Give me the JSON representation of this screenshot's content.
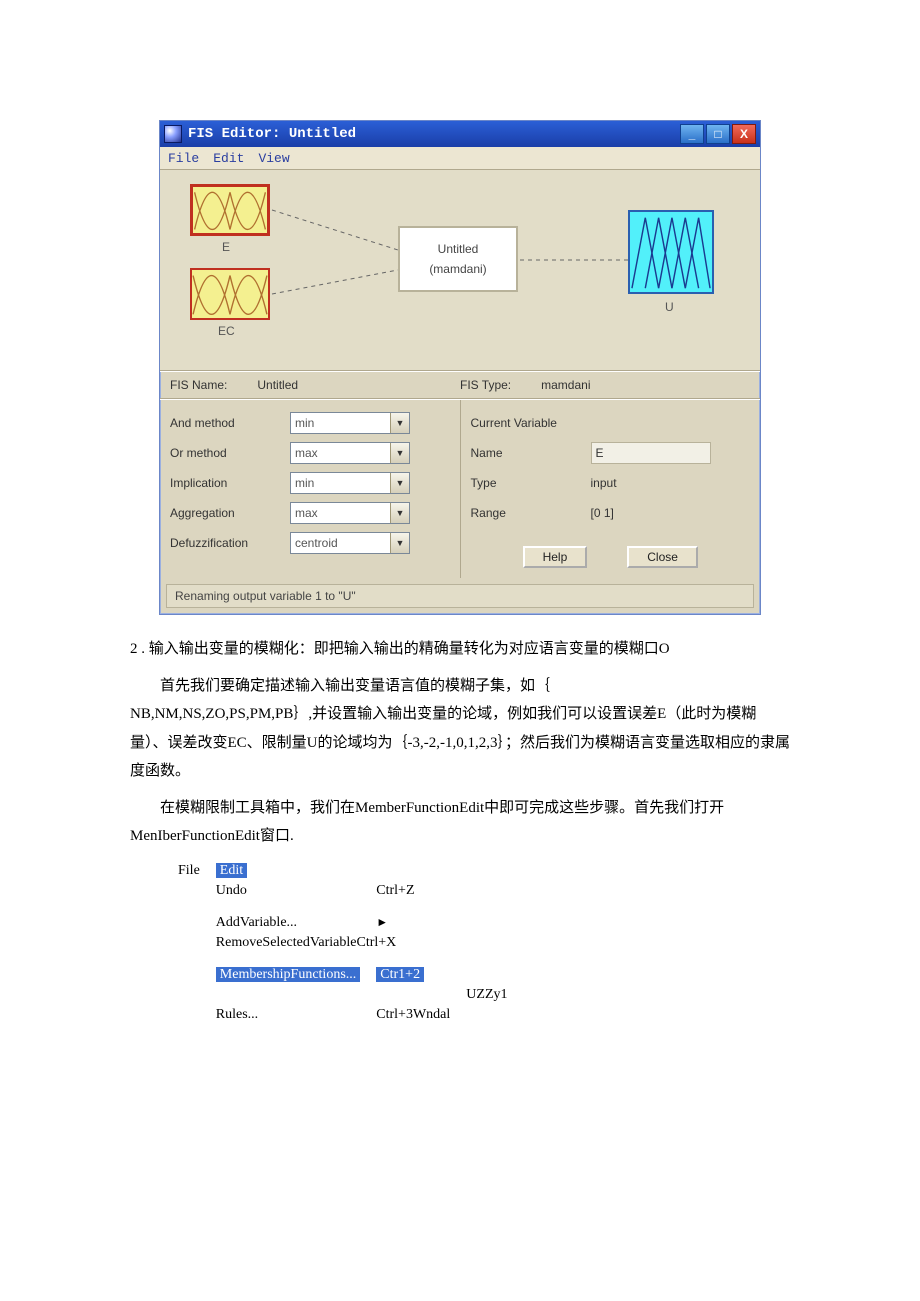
{
  "fis_window": {
    "title": "FIS Editor: Untitled",
    "menubar": [
      "File",
      "Edit",
      "View"
    ],
    "inputs": [
      {
        "label": "E"
      },
      {
        "label": "EC"
      }
    ],
    "rule_block": {
      "line1": "Untitled",
      "line2": "(mamdani)"
    },
    "output": {
      "label": "U"
    },
    "info": {
      "fis_name_label": "FIS Name:",
      "fis_name_value": "Untitled",
      "fis_type_label": "FIS Type:",
      "fis_type_value": "mamdani"
    },
    "left_fields": [
      {
        "label": "And method",
        "value": "min"
      },
      {
        "label": "Or method",
        "value": "max"
      },
      {
        "label": "Implication",
        "value": "min"
      },
      {
        "label": "Aggregation",
        "value": "max"
      },
      {
        "label": "Defuzzification",
        "value": "centroid"
      }
    ],
    "right": {
      "section_label": "Current Variable",
      "name_label": "Name",
      "name_value": "E",
      "type_label": "Type",
      "type_value": "input",
      "range_label": "Range",
      "range_value": "[0 1]",
      "help_btn": "Help",
      "close_btn": "Close"
    },
    "status": "Renaming output variable 1 to \"U\""
  },
  "body": {
    "p1": "2 . 输入输出变量的模糊化：即把输入输出的精确量转化为对应语言变量的模糊口O",
    "p2a": "首先我们要确定描述输入输出变量语言值的模糊子集，如｛",
    "p2b": "NB,NM,NS,ZO,PS,PM,PB｝,并设置输入输出变量的论域，例如我们可以设置误差E（此时为模糊量）、误差改变EC、限制量U的论域均为｛-3,-2,-1,0,1,2,3｝；然后我们为模糊语言变量选取相应的隶属度函数。",
    "p3": "在模糊限制工具箱中，我们在MemberFunctionEdit中即可完成这些步骤。首先我们打开MenIberFunctionEdit窗口."
  },
  "menu_fig": {
    "file": "File",
    "edit": "Edit",
    "items": [
      {
        "label": "Undo",
        "short": "Ctrl+Z"
      },
      {
        "label": "AddVariable...",
        "short": "►"
      },
      {
        "label": "RemoveSelectedVariableCtrl+X",
        "short": ""
      },
      {
        "label": "MembershipFunctions...",
        "short": "Ctr1+2",
        "hl": true
      },
      {
        "label": "Rules...",
        "short": "Ctrl+3Wndal"
      }
    ],
    "side_text": "UZZy1"
  }
}
